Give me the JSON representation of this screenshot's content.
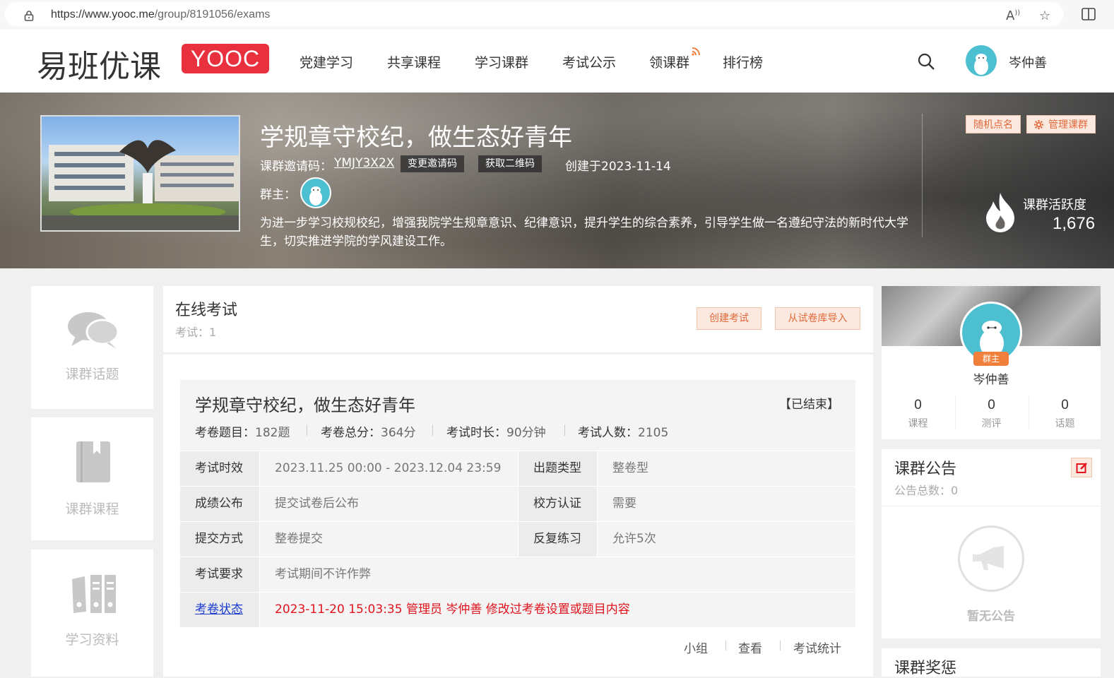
{
  "browser": {
    "url_prefix": "https://www.yooc.me",
    "url_path": "/group/8191056/exams"
  },
  "header": {
    "logo_text": "易班优课",
    "logo_badge": "YOOC",
    "nav": [
      "党建学习",
      "共享课程",
      "学习课群",
      "考试公示",
      "领课群",
      "排行榜"
    ],
    "user_name": "岑仲善"
  },
  "banner": {
    "title": "学规章守校纪，做生态好青年",
    "invite_label": "课群邀请码：",
    "invite_code": "YMJY3X2X",
    "change_code": "变更邀请码",
    "get_qr": "获取二维码",
    "created": "创建于2023-11-14",
    "owner_label": "群主：",
    "description": "为进一步学习校规校纪，增强我院学生规章意识、纪律意识，提升学生的综合素养，引导学生做一名遵纪守法的新时代大学生，切实推进学院的学风建设工作。",
    "random_call": "随机点名",
    "manage": "管理课群",
    "activity_label": "课群活跃度",
    "activity_value": "1,676"
  },
  "sidebar": {
    "items": [
      {
        "label": "课群话题",
        "icon": "chat-bubbles-icon"
      },
      {
        "label": "课群课程",
        "icon": "book-icon"
      },
      {
        "label": "学习资料",
        "icon": "binders-icon"
      }
    ]
  },
  "main": {
    "title": "在线考试",
    "count": "考试：1",
    "create_exam": "创建考试",
    "import_exam": "从试卷库导入",
    "exam": {
      "title": "学规章守校纪，做生态好青年",
      "status": "【已结束】",
      "questions_label": "考卷题目：",
      "questions": "182题",
      "score_label": "考卷总分：",
      "score": "364分",
      "duration_label": "考试时长：",
      "duration": "90分钟",
      "people_label": "考试人数：",
      "people": "2105",
      "rows": [
        {
          "k1": "考试时效",
          "v1": "2023.11.25 00:00 - 2023.12.04 23:59",
          "k2": "出题类型",
          "v2": "整卷型"
        },
        {
          "k1": "成绩公布",
          "v1": "提交试卷后公布",
          "k2": "校方认证",
          "v2": "需要"
        },
        {
          "k1": "提交方式",
          "v1": "整卷提交",
          "k2": "反复练习",
          "v2": "允许5次"
        }
      ],
      "requirement_label": "考试要求",
      "requirement": "考试期间不许作弊",
      "paper_status_label": "考卷状态",
      "paper_status": "2023-11-20 15:03:35 管理员 岑仲善 修改过考卷设置或题目内容",
      "actions": [
        "小组",
        "查看",
        "考试统计"
      ]
    }
  },
  "profile": {
    "name": "岑仲善",
    "tag": "群主",
    "stats": [
      {
        "n": "0",
        "l": "课程"
      },
      {
        "n": "0",
        "l": "测评"
      },
      {
        "n": "0",
        "l": "话题"
      }
    ]
  },
  "notice": {
    "title": "课群公告",
    "count": "公告总数：0",
    "empty": "暂无公告"
  },
  "reward": {
    "title": "课群奖惩"
  },
  "colors": {
    "brand_red": "#e8303f",
    "accent_orange": "#e06a3c",
    "status_red": "#e0141e",
    "link_blue": "#1a3ad0"
  }
}
